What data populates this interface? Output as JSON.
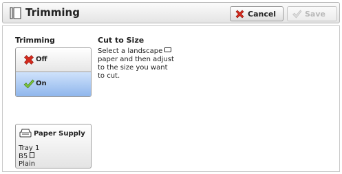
{
  "header": {
    "title": "Trimming",
    "cancel_label": "Cancel",
    "save_label": "Save"
  },
  "trimming": {
    "label": "Trimming",
    "options": [
      {
        "label": "Off",
        "icon": "red-x-icon",
        "selected": false
      },
      {
        "label": "On",
        "icon": "green-check-icon",
        "selected": true
      }
    ]
  },
  "description": {
    "title": "Cut to Size",
    "lines": [
      "Select a landscape",
      "paper and then adjust",
      "to the size you want",
      "to cut."
    ]
  },
  "paper_supply": {
    "label": "Paper Supply",
    "tray": "Tray 1",
    "size": "B5",
    "type": "Plain"
  },
  "colors": {
    "selected_bg": "#8fb6ec",
    "cancel_icon": "#d42a1e",
    "check_icon": "#7cc43a"
  }
}
